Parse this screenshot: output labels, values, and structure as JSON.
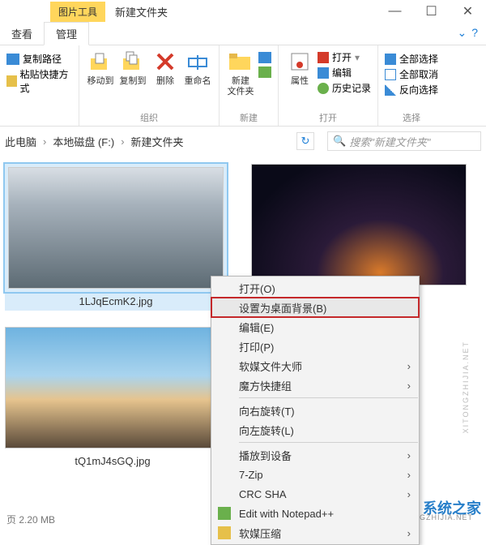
{
  "window": {
    "tool_tab": "图片工具",
    "title": "新建文件夹",
    "controls": {
      "min": "—",
      "max": "☐",
      "close": "✕"
    }
  },
  "tabs": {
    "view": "查看",
    "manage": "管理"
  },
  "help": {
    "q": "?",
    "caret": "⌄"
  },
  "ribbon": {
    "clipboard": {
      "copy_path": "复制路径",
      "paste_shortcut": "粘贴快捷方式",
      "label": ""
    },
    "organize": {
      "move_to": "移动到",
      "copy_to": "复制到",
      "delete": "删除",
      "rename": "重命名",
      "label": "组织"
    },
    "new": {
      "new_folder": "新建\n文件夹",
      "label": "新建"
    },
    "open": {
      "properties": "属性",
      "open": "打开",
      "edit": "编辑",
      "history": "历史记录",
      "label": "打开"
    },
    "select": {
      "select_all": "全部选择",
      "select_none": "全部取消",
      "invert": "反向选择",
      "label": "选择"
    }
  },
  "breadcrumb": {
    "parts": [
      "此电脑",
      "本地磁盘 (F:)",
      "新建文件夹"
    ],
    "sep": "›"
  },
  "search": {
    "placeholder": "搜索\"新建文件夹\""
  },
  "files": [
    {
      "name": "1LJqEcmK2.jpg"
    },
    {
      "name": ""
    },
    {
      "name": "tQ1mJ4sGQ.jpg"
    }
  ],
  "context_menu": {
    "items": [
      {
        "label": "打开(O)",
        "sep_after": false
      },
      {
        "label": "设置为桌面背景(B)",
        "highlighted": true
      },
      {
        "label": "编辑(E)"
      },
      {
        "label": "打印(P)"
      },
      {
        "label": "软媒文件大师",
        "submenu": true
      },
      {
        "label": "魔方快捷组",
        "submenu": true,
        "sep_after": true
      },
      {
        "label": "向右旋转(T)"
      },
      {
        "label": "向左旋转(L)",
        "sep_after": true
      },
      {
        "label": "播放到设备",
        "submenu": true
      },
      {
        "label": "7-Zip",
        "submenu": true
      },
      {
        "label": "CRC SHA",
        "submenu": true
      },
      {
        "label": "Edit with Notepad++",
        "icon": "npp"
      },
      {
        "label": "软媒压缩",
        "submenu": true,
        "icon": "zip"
      }
    ]
  },
  "status": "页  2.20 MB",
  "watermark": {
    "text": "系统之家",
    "url": "XITONGZHIJIA.NET"
  }
}
